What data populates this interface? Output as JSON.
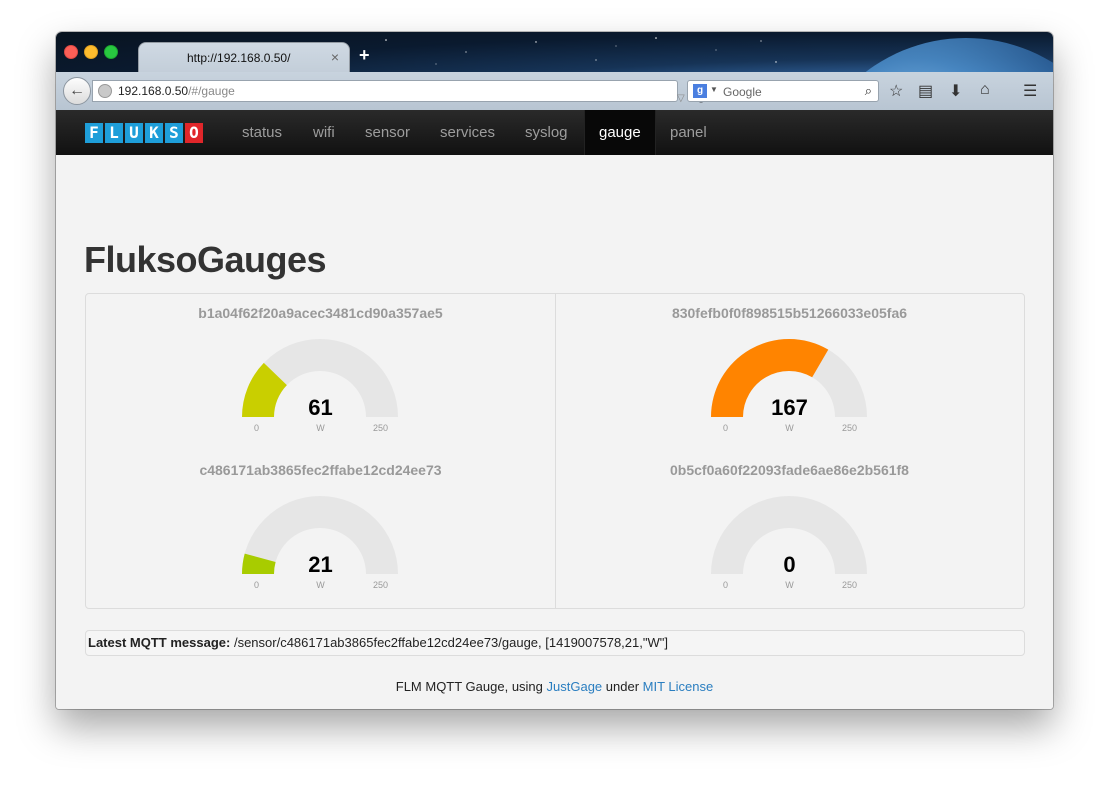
{
  "browser": {
    "tab_title": "http://192.168.0.50/",
    "tab_close": "×",
    "new_tab": "+",
    "url_host": "192.168.0.50",
    "url_path": "/#/gauge",
    "search_placeholder": "Google",
    "icons": [
      "back-icon",
      "globe-icon",
      "reload-icon",
      "google-icon",
      "search-icon",
      "bookmark-star-icon",
      "reading-list-icon",
      "download-icon",
      "home-icon",
      "menu-icon"
    ]
  },
  "navbar": {
    "logo_letters": [
      "F",
      "L",
      "U",
      "K",
      "S",
      "O"
    ],
    "items": [
      {
        "label": "status"
      },
      {
        "label": "wifi"
      },
      {
        "label": "sensor"
      },
      {
        "label": "services"
      },
      {
        "label": "syslog"
      },
      {
        "label": "gauge",
        "active": true
      },
      {
        "label": "panel"
      }
    ]
  },
  "page": {
    "title": "FluksoGauges"
  },
  "gauges": [
    {
      "title": "b1a04f62f20a9acec3481cd90a357ae5",
      "value": "61",
      "unit": "W",
      "min": "0",
      "max": "250",
      "level": 61,
      "color": "#c9cf00"
    },
    {
      "title": "830fefb0f0f898515b51266033e05fa6",
      "value": "167",
      "unit": "W",
      "min": "0",
      "max": "250",
      "level": 167,
      "color": "#ff8400"
    },
    {
      "title": "c486171ab3865fec2ffabe12cd24ee73",
      "value": "21",
      "unit": "W",
      "min": "0",
      "max": "250",
      "level": 21,
      "color": "#a8cc00"
    },
    {
      "title": "0b5cf0a60f22093fade6ae86e2b561f8",
      "value": "0",
      "unit": "W",
      "min": "0",
      "max": "250",
      "level": 0,
      "color": "#a8cc00"
    }
  ],
  "mqtt": {
    "label": "Latest MQTT message:",
    "message": "/sensor/c486171ab3865fec2ffabe12cd24ee73/gauge, [1419007578,21,\"W\"]"
  },
  "footer": {
    "text_before": "FLM MQTT Gauge, using ",
    "link1": "JustGage",
    "text_middle": " under ",
    "link2": "MIT License"
  },
  "colors": {
    "gauge_track": "#e6e6e6",
    "navbar_bg": "#1b1b1b",
    "link": "#2a7ec0",
    "logo_blue": "#1e9ed9",
    "logo_red": "#e0262a"
  }
}
